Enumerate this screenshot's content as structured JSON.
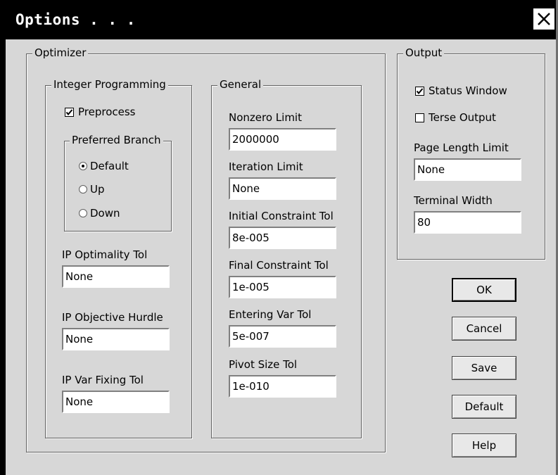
{
  "window": {
    "title": "Options . . .",
    "close_icon": "close-icon"
  },
  "optimizer": {
    "legend": "Optimizer",
    "integer_programming": {
      "legend": "Integer Programming",
      "preprocess": {
        "label": "Preprocess",
        "checked": true
      },
      "preferred_branch": {
        "legend": "Preferred Branch",
        "options": [
          {
            "label": "Default",
            "selected": true
          },
          {
            "label": "Up",
            "selected": false
          },
          {
            "label": "Down",
            "selected": false
          }
        ]
      },
      "ip_optimality_tol": {
        "label": "IP Optimality Tol",
        "value": "None"
      },
      "ip_objective_hurdle": {
        "label": "IP Objective Hurdle",
        "value": "None"
      },
      "ip_var_fixing_tol": {
        "label": "IP Var Fixing Tol",
        "value": "None"
      }
    },
    "general": {
      "legend": "General",
      "nonzero_limit": {
        "label": "Nonzero Limit",
        "value": "2000000"
      },
      "iteration_limit": {
        "label": "Iteration Limit",
        "value": "None"
      },
      "initial_constraint_tol": {
        "label": "Initial Constraint Tol",
        "value": "8e-005"
      },
      "final_constraint_tol": {
        "label": "Final Constraint Tol",
        "value": "1e-005"
      },
      "entering_var_tol": {
        "label": "Entering Var Tol",
        "value": "5e-007"
      },
      "pivot_size_tol": {
        "label": "Pivot Size Tol",
        "value": "1e-010"
      }
    }
  },
  "output": {
    "legend": "Output",
    "status_window": {
      "label": "Status Window",
      "checked": true
    },
    "terse_output": {
      "label": "Terse Output",
      "checked": false
    },
    "page_length_limit": {
      "label": "Page Length Limit",
      "value": "None"
    },
    "terminal_width": {
      "label": "Terminal Width",
      "value": "80"
    }
  },
  "buttons": {
    "ok": "OK",
    "cancel": "Cancel",
    "save": "Save",
    "default": "Default",
    "help": "Help"
  }
}
